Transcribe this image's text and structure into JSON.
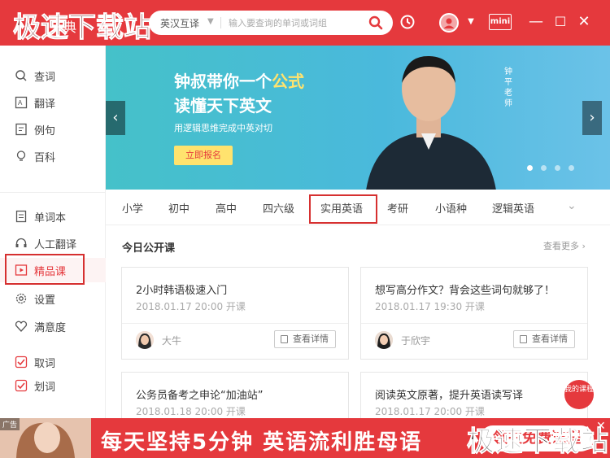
{
  "app": {
    "logo_text": "极速下载站",
    "logo_sub": "典"
  },
  "search": {
    "mode": "英汉互译",
    "placeholder": "输入要查询的单词或词组"
  },
  "topbar": {
    "mini_label": "mini",
    "minimize": "—",
    "maximize": "☐",
    "close": "✕"
  },
  "sidebar": {
    "items": [
      {
        "label": "查词",
        "icon": "search-icon"
      },
      {
        "label": "翻译",
        "icon": "translate-icon"
      },
      {
        "label": "例句",
        "icon": "sentence-icon"
      },
      {
        "label": "百科",
        "icon": "bulb-icon"
      },
      {
        "label": "单词本",
        "icon": "wordbook-icon"
      },
      {
        "label": "人工翻译",
        "icon": "headset-icon"
      },
      {
        "label": "精品课",
        "icon": "course-icon"
      },
      {
        "label": "设置",
        "icon": "gear-icon"
      },
      {
        "label": "满意度",
        "icon": "heart-icon"
      },
      {
        "label": "取词",
        "icon": "checkbox-icon"
      },
      {
        "label": "划词",
        "icon": "checkbox-icon"
      }
    ]
  },
  "banner": {
    "line1_a": "钟叔带你一个",
    "line1_b": "公式",
    "line2": "读懂天下英文",
    "subtitle": "用逻辑思维完成中英对切",
    "cta": "立即报名",
    "teacher_tag": "钟平老师",
    "prev": "‹",
    "next": "›"
  },
  "tabs": [
    "小学",
    "初中",
    "高中",
    "四六级",
    "实用英语",
    "考研",
    "小语种",
    "逻辑英语"
  ],
  "section": {
    "title": "今日公开课",
    "more": "查看更多 ›"
  },
  "courses": [
    {
      "title": "2小时韩语极速入门",
      "date": "2018.01.17 20:00 开课",
      "teacher": "大牛",
      "button": "查看详情"
    },
    {
      "title": "想写高分作文？背会这些词句就够了！",
      "date": "2018.01.17 19:30 开课",
      "teacher": "于欣宇",
      "button": "查看详情"
    },
    {
      "title": "公务员备考之申论“加油站”",
      "date": "2018.01.18 20:00 开课"
    },
    {
      "title": "阅读英文原著，提升英语读写译",
      "date": "2018.01.17 20:00 开课"
    }
  ],
  "my_course": "我的课程",
  "ad": {
    "tag": "广告",
    "text": "每天坚持5分钟 英语流利胜母语",
    "button": "领取免费课程",
    "close": "✕"
  },
  "watermark": "极速下载站",
  "colors": {
    "brand_red": "#e5393d",
    "banner_teal": "#45c1c9",
    "highlight_yellow": "#ffe36e"
  }
}
